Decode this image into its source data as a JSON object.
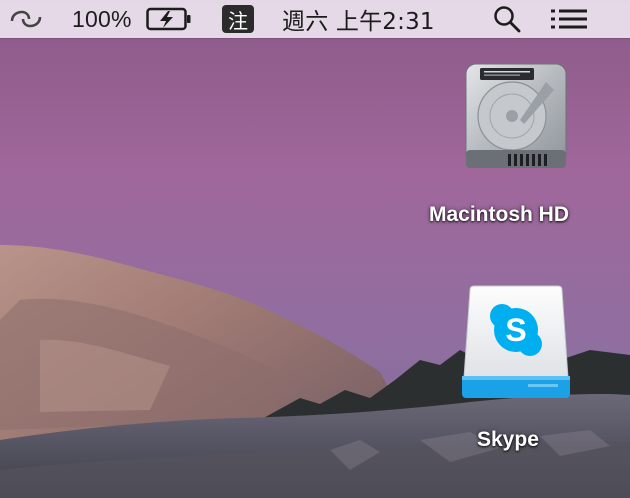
{
  "menubar": {
    "status_icon": "link-status-icon",
    "battery_percent": "100%",
    "battery_icon": "battery-charging-icon",
    "ime_char": "注",
    "datetime": "週六 上午2:31",
    "search_icon": "spotlight-search-icon",
    "menu_icon": "notification-center-icon",
    "bar_color": "#ece2ee"
  },
  "desktop": {
    "icons": [
      {
        "label": "Macintosh HD",
        "icon": "hard-drive-icon"
      },
      {
        "label": "Skype",
        "icon": "skype-drive-icon",
        "accent": "#1ba1e8"
      }
    ]
  }
}
